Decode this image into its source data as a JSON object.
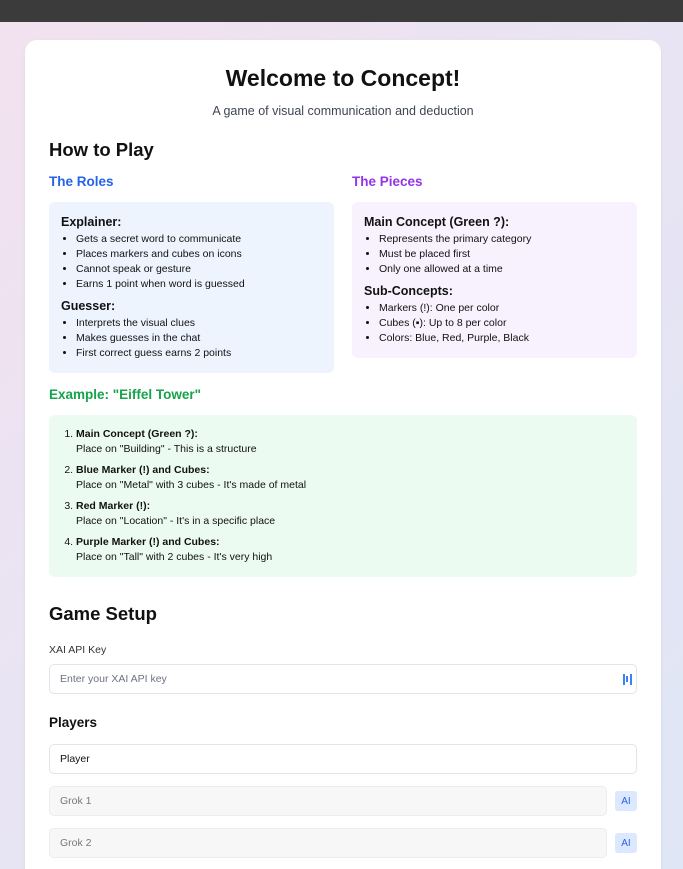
{
  "title": "Welcome to Concept!",
  "subtitle": "A game of visual communication and deduction",
  "how_to_play": {
    "heading": "How to Play",
    "roles": {
      "heading": "The Roles",
      "explainer": {
        "title": "Explainer:",
        "items": [
          "Gets a secret word to communicate",
          "Places markers and cubes on icons",
          "Cannot speak or gesture",
          "Earns 1 point when word is guessed"
        ]
      },
      "guesser": {
        "title": "Guesser:",
        "items": [
          "Interprets the visual clues",
          "Makes guesses in the chat",
          "First correct guess earns 2 points"
        ]
      }
    },
    "pieces": {
      "heading": "The Pieces",
      "main": {
        "title": "Main Concept (Green ?):",
        "items": [
          "Represents the primary category",
          "Must be placed first",
          "Only one allowed at a time"
        ]
      },
      "sub": {
        "title": "Sub-Concepts:",
        "items": [
          "Markers (!): One per color",
          "Cubes (▪): Up to 8 per color",
          "Colors: Blue, Red, Purple, Black"
        ]
      }
    },
    "example": {
      "heading": "Example: \"Eiffel Tower\"",
      "steps": [
        {
          "title": "Main Concept (Green ?):",
          "text": "Place on \"Building\" - This is a structure"
        },
        {
          "title": "Blue Marker (!) and Cubes:",
          "text": "Place on \"Metal\" with 3 cubes - It's made of metal"
        },
        {
          "title": "Red Marker (!):",
          "text": "Place on \"Location\" - It's in a specific place"
        },
        {
          "title": "Purple Marker (!) and Cubes:",
          "text": "Place on \"Tall\" with 2 cubes - It's very high"
        }
      ]
    }
  },
  "setup": {
    "heading": "Game Setup",
    "api_label": "XAI API Key",
    "api_placeholder": "Enter your XAI API key",
    "players_heading": "Players",
    "players": [
      {
        "name": "Player",
        "ai": false
      },
      {
        "name": "Grok 1",
        "ai": true,
        "badge": "AI"
      },
      {
        "name": "Grok 2",
        "ai": true,
        "badge": "AI"
      }
    ]
  }
}
